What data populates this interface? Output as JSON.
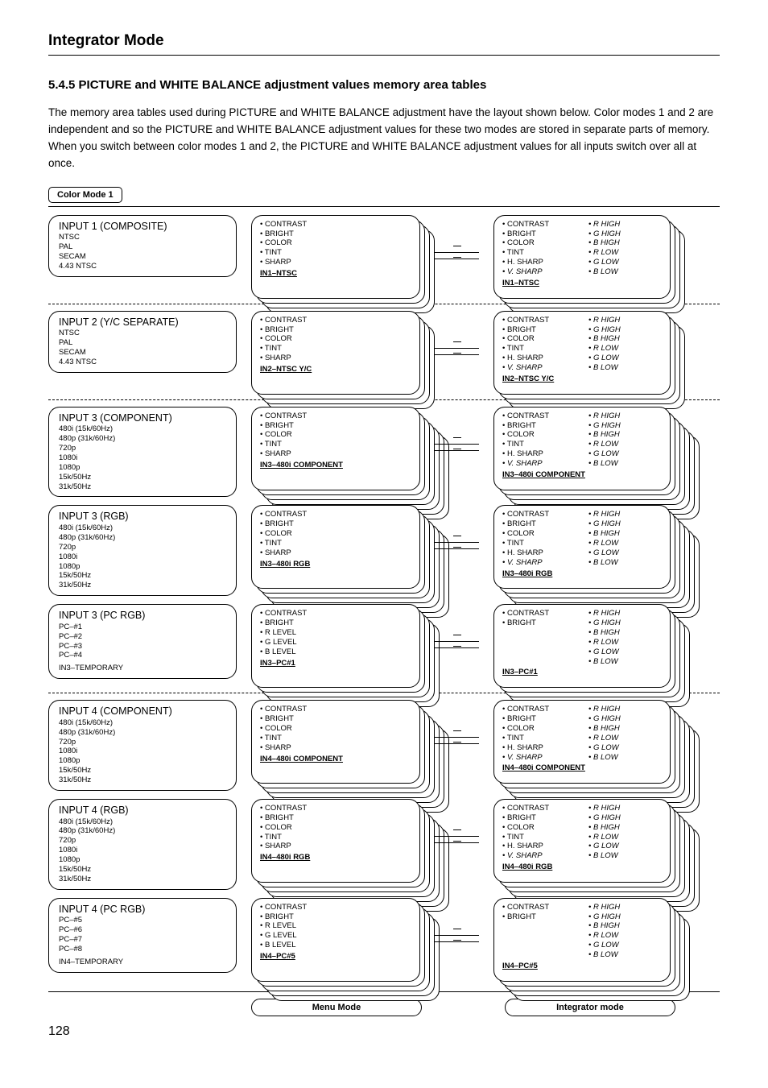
{
  "page": {
    "title": "Integrator Mode",
    "section": "5.4.5  PICTURE and WHITE BALANCE adjustment values memory area tables",
    "body": "The memory area tables used during PICTURE and WHITE BALANCE adjustment have the layout shown below. Color modes 1 and 2 are independent and so the PICTURE and WHITE BALANCE adjustment values for these two modes are stored in separate parts of memory. When you switch between color modes 1 and 2, the PICTURE and WHITE BALANCE adjustment values for all inputs switch over all at once.",
    "mode_badge": "Color Mode 1",
    "menu_mode_label": "Menu Mode",
    "integrator_mode_label": "Integrator mode",
    "page_number": "128"
  },
  "groups": [
    {
      "sep_before": false,
      "input": {
        "title": "INPUT 1 (COMPOSITE)",
        "subs": [
          "NTSC",
          "PAL",
          "SECAM",
          "4.43 NTSC"
        ],
        "extra": ""
      },
      "depth": 4,
      "menu": {
        "items": [
          "• CONTRAST",
          "• BRIGHT",
          "• COLOR",
          "• TINT",
          "• SHARP"
        ],
        "label": "IN1–NTSC"
      },
      "int": {
        "left": [
          "• CONTRAST",
          "• BRIGHT",
          "• COLOR",
          "• TINT",
          "• H. SHARP",
          "• V. SHARP"
        ],
        "right": [
          "• R HIGH",
          "• G HIGH",
          "• B HIGH",
          "• R LOW",
          "• G LOW",
          "• B LOW"
        ],
        "label": "IN1–NTSC"
      }
    },
    {
      "sep_before": true,
      "input": {
        "title": "INPUT 2 (Y/C SEPARATE)",
        "subs": [
          "NTSC",
          "PAL",
          "SECAM",
          "4.43 NTSC"
        ],
        "extra": ""
      },
      "depth": 4,
      "menu": {
        "items": [
          "• CONTRAST",
          "• BRIGHT",
          "• COLOR",
          "• TINT",
          "• SHARP"
        ],
        "label": "IN2–NTSC  Y/C"
      },
      "int": {
        "left": [
          "• CONTRAST",
          "• BRIGHT",
          "• COLOR",
          "• TINT",
          "• H. SHARP",
          "• V. SHARP"
        ],
        "right": [
          "• R HIGH",
          "• G HIGH",
          "• B HIGH",
          "• R LOW",
          "• G LOW",
          "• B LOW"
        ],
        "label": "IN2–NTSC  Y/C"
      }
    },
    {
      "sep_before": true,
      "input": {
        "title": "INPUT 3 (COMPONENT)",
        "subs": [
          "480i (15k/60Hz)",
          "480p (31k/60Hz)",
          "720p",
          "1080i",
          "1080p",
          "15k/50Hz",
          "31k/50Hz"
        ],
        "extra": ""
      },
      "depth": 7,
      "menu": {
        "items": [
          "• CONTRAST",
          "• BRIGHT",
          "• COLOR",
          "• TINT",
          "• SHARP"
        ],
        "label": "IN3–480i    COMPONENT"
      },
      "int": {
        "left": [
          "• CONTRAST",
          "• BRIGHT",
          "• COLOR",
          "• TINT",
          "• H. SHARP",
          "• V. SHARP"
        ],
        "right": [
          "• R HIGH",
          "• G HIGH",
          "• B HIGH",
          "• R LOW",
          "• G LOW",
          "• B LOW"
        ],
        "label": "IN3–480i   COMPONENT"
      }
    },
    {
      "sep_before": false,
      "input": {
        "title": "INPUT 3 (RGB)",
        "subs": [
          "480i (15k/60Hz)",
          "480p (31k/60Hz)",
          "720p",
          "1080i",
          "1080p",
          "15k/50Hz",
          "31k/50Hz"
        ],
        "extra": ""
      },
      "depth": 7,
      "menu": {
        "items": [
          "• CONTRAST",
          "• BRIGHT",
          "• COLOR",
          "• TINT",
          "• SHARP"
        ],
        "label": "IN3–480i    RGB"
      },
      "int": {
        "left": [
          "• CONTRAST",
          "• BRIGHT",
          "• COLOR",
          "• TINT",
          "• H. SHARP",
          "• V. SHARP"
        ],
        "right": [
          "• R HIGH",
          "• G HIGH",
          "• B HIGH",
          "• R LOW",
          "• G LOW",
          "• B LOW"
        ],
        "label": "IN3–480i    RGB"
      }
    },
    {
      "sep_before": false,
      "input": {
        "title": "INPUT 3 (PC RGB)",
        "subs": [
          "PC–#1",
          "PC–#2",
          "PC–#3",
          "PC–#4"
        ],
        "extra": "IN3–TEMPORARY"
      },
      "depth": 5,
      "menu": {
        "items": [
          "• CONTRAST",
          "• BRIGHT",
          "• R LEVEL",
          "• G LEVEL",
          "• B LEVEL"
        ],
        "label": "IN3–PC#1"
      },
      "int": {
        "left": [
          "• CONTRAST",
          "• BRIGHT"
        ],
        "right": [
          "• R HIGH",
          "• G HIGH",
          "• B HIGH",
          "• R LOW",
          "• G LOW",
          "• B LOW"
        ],
        "label": "IN3–PC#1"
      }
    },
    {
      "sep_before": true,
      "input": {
        "title": "INPUT 4 (COMPONENT)",
        "subs": [
          "480i (15k/60Hz)",
          "480p (31k/60Hz)",
          "720p",
          "1080i",
          "1080p",
          "15k/50Hz",
          "31k/50Hz"
        ],
        "extra": ""
      },
      "depth": 7,
      "menu": {
        "items": [
          "• CONTRAST",
          "• BRIGHT",
          "• COLOR",
          "• TINT",
          "• SHARP"
        ],
        "label": "IN4–480i    COMPONENT"
      },
      "int": {
        "left": [
          "• CONTRAST",
          "• BRIGHT",
          "• COLOR",
          "• TINT",
          "• H. SHARP",
          "• V. SHARP"
        ],
        "right": [
          "• R HIGH",
          "• G HIGH",
          "• B HIGH",
          "• R LOW",
          "• G LOW",
          "• B LOW"
        ],
        "label": "IN4–480i    COMPONENT"
      }
    },
    {
      "sep_before": false,
      "input": {
        "title": "INPUT 4 (RGB)",
        "subs": [
          "480i (15k/60Hz)",
          "480p (31k/60Hz)",
          "720p",
          "1080i",
          "1080p",
          "15k/50Hz",
          "31k/50Hz"
        ],
        "extra": ""
      },
      "depth": 7,
      "menu": {
        "items": [
          "• CONTRAST",
          "• BRIGHT",
          "• COLOR",
          "• TINT",
          "• SHARP"
        ],
        "label": "IN4–480i    RGB"
      },
      "int": {
        "left": [
          "• CONTRAST",
          "• BRIGHT",
          "• COLOR",
          "• TINT",
          "• H. SHARP",
          "• V. SHARP"
        ],
        "right": [
          "• R HIGH",
          "• G HIGH",
          "• B HIGH",
          "• R LOW",
          "• G LOW",
          "• B LOW"
        ],
        "label": "IN4–480i    RGB"
      }
    },
    {
      "sep_before": false,
      "input": {
        "title": "INPUT 4 (PC RGB)",
        "subs": [
          "PC–#5",
          "PC–#6",
          "PC–#7",
          "PC–#8"
        ],
        "extra": "IN4–TEMPORARY"
      },
      "depth": 5,
      "menu": {
        "items": [
          "• CONTRAST",
          "• BRIGHT",
          "• R LEVEL",
          "• G LEVEL",
          "• B LEVEL"
        ],
        "label": "IN4–PC#5"
      },
      "int": {
        "left": [
          "• CONTRAST",
          "• BRIGHT"
        ],
        "right": [
          "• R HIGH",
          "• G HIGH",
          "• B HIGH",
          "• R LOW",
          "• G LOW",
          "• B LOW"
        ],
        "label": "IN4–PC#5"
      }
    }
  ]
}
